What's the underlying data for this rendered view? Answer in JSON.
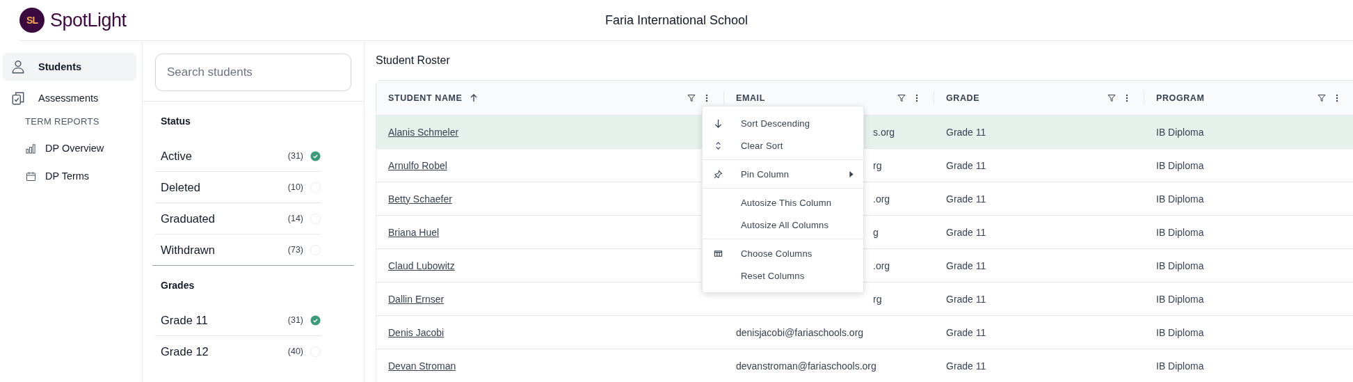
{
  "header": {
    "brand": "SpotLight",
    "logo_text": "SL",
    "school": "Faria International School"
  },
  "nav": {
    "items": [
      {
        "label": "Students",
        "kind": "person",
        "selected": true
      },
      {
        "label": "Assessments",
        "kind": "clipboard",
        "selected": false
      }
    ],
    "section": "TERM REPORTS",
    "sub_items": [
      {
        "label": "DP Overview",
        "kind": "chart",
        "selected": false
      },
      {
        "label": "DP Terms",
        "kind": "calendar",
        "selected": false
      }
    ]
  },
  "filters": {
    "search": {
      "placeholder": "Search students"
    },
    "groups": [
      {
        "title": "Status",
        "options": [
          {
            "label": "Active",
            "count": "(31)",
            "checked": true
          },
          {
            "label": "Deleted",
            "count": "(10)",
            "checked": false
          },
          {
            "label": "Graduated",
            "count": "(14)",
            "checked": false
          },
          {
            "label": "Withdrawn",
            "count": "(73)",
            "checked": false
          }
        ]
      },
      {
        "title": "Grades",
        "options": [
          {
            "label": "Grade 11",
            "count": "(31)",
            "checked": true
          },
          {
            "label": "Grade 12",
            "count": "(40)",
            "checked": false
          }
        ]
      }
    ]
  },
  "roster": {
    "title": "Student Roster",
    "columns": [
      {
        "label": "STUDENT NAME",
        "sorted": true
      },
      {
        "label": "EMAIL",
        "sorted": false
      },
      {
        "label": "GRADE",
        "sorted": false
      },
      {
        "label": "PROGRAM",
        "sorted": false
      }
    ],
    "rows": [
      {
        "name": "Alanis Schmeler",
        "email": "s.org",
        "grade": "Grade 11",
        "program": "IB Diploma",
        "selected": true
      },
      {
        "name": "Arnulfo Robel",
        "email": "rg",
        "grade": "Grade 11",
        "program": "IB Diploma",
        "selected": false
      },
      {
        "name": "Betty Schaefer",
        "email": ".org",
        "grade": "Grade 11",
        "program": "IB Diploma",
        "selected": false
      },
      {
        "name": "Briana Huel",
        "email": "g",
        "grade": "Grade 11",
        "program": "IB Diploma",
        "selected": false
      },
      {
        "name": "Claud Lubowitz",
        "email": ".org",
        "grade": "Grade 11",
        "program": "IB Diploma",
        "selected": false
      },
      {
        "name": "Dallin Ernser",
        "email": "rg",
        "grade": "Grade 11",
        "program": "IB Diploma",
        "selected": false
      },
      {
        "name": "Denis Jacobi",
        "email": "denisjacobi@fariaschools.org",
        "grade": "Grade 11",
        "program": "IB Diploma",
        "selected": false
      },
      {
        "name": "Devan Stroman",
        "email": "devanstroman@fariaschools.org",
        "grade": "Grade 11",
        "program": "IB Diploma",
        "selected": false
      }
    ],
    "column_menu": {
      "groups": [
        [
          {
            "label": "Sort Descending",
            "kind": "arrow-down",
            "submenu": false
          },
          {
            "label": "Clear Sort",
            "kind": "updown",
            "submenu": false
          }
        ],
        [
          {
            "label": "Pin Column",
            "kind": "pin",
            "submenu": true
          }
        ],
        [
          {
            "label": "Autosize This Column",
            "kind": "none",
            "submenu": false
          },
          {
            "label": "Autosize All Columns",
            "kind": "none",
            "submenu": false
          }
        ],
        [
          {
            "label": "Choose Columns",
            "kind": "columns",
            "submenu": false
          },
          {
            "label": "Reset Columns",
            "kind": "none",
            "submenu": false
          }
        ]
      ]
    }
  }
}
